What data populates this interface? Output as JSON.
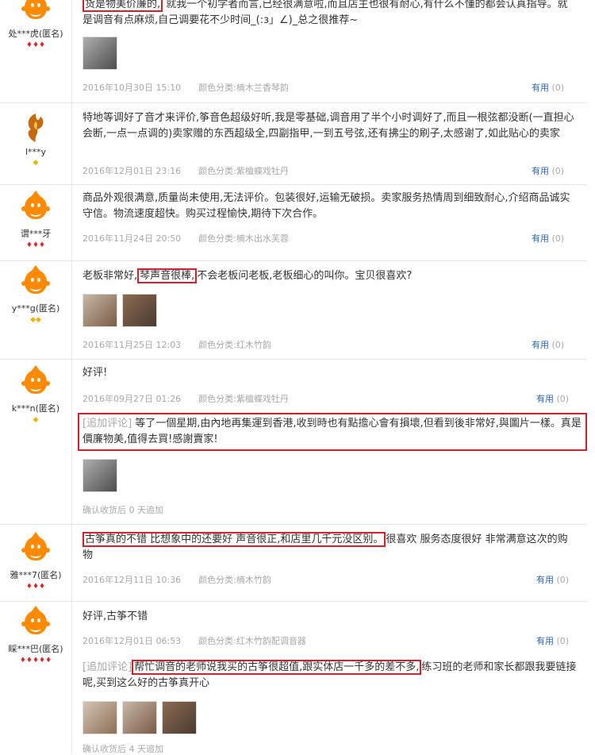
{
  "reviews": [
    {
      "user": "处***虎(匿名)",
      "ranks": "♦♦♦",
      "text_hl": "货是物美价廉的,",
      "text_rest": " 就我一个初学者而言,已经很满意啦,而且店主也很有耐心,有什么不懂的都会认真指导。就是调音有点麻烦,自己调要花不少时间_(:з」∠)_总之很推荐~",
      "date": "2016年10月30日 15:10",
      "color": "颜色分类:楠木兰香琴韵",
      "helpful": "有用",
      "count": "(0)"
    },
    {
      "user": "l***y",
      "ranks": "◆",
      "text": "特地等调好了音才来评价,筝音色超级好听,我是零基础,调音用了半个小时调好了,而且一根弦都没断(一直担心会断,一点一点调的)卖家赠的东西超级全,四副指甲,一到五号弦,还有拂尘的刷子,太感谢了,如此贴心的卖家",
      "date": "2016年12月01日 23:16",
      "color": "颜色分类:紫檀蝶戏牡丹",
      "helpful": "有用",
      "count": "(0)"
    },
    {
      "user": "谓***牙",
      "ranks": "♦♦♦",
      "text": "商品外观很满意,质量尚未使用,无法评价。包装很好,运输无破损。卖家服务热情周到细致耐心,介绍商品诚实守信。物流速度超快。购买过程愉快,期待下次合作。",
      "date": "2016年11月24日 20:50",
      "color": "颜色分类:楠木出水芙蓉",
      "helpful": "有用",
      "count": "(0)"
    },
    {
      "user": "y***g(匿名)",
      "ranks": "◆◆",
      "text_pre": "老板非常好,",
      "text_hl": "琴声音很棒,",
      "text_rest": "不会老板问老板,老板细心的叫你。宝贝很喜欢?",
      "date": "2016年11月25日 12:03",
      "color": "颜色分类:红木竹韵",
      "helpful": "有用",
      "count": "(0)"
    },
    {
      "user": "k***n(匿名)",
      "ranks": "◆",
      "text": "好评!",
      "date": "2016年09月27日 01:26",
      "color": "颜色分类:紫檀蝶戏牡丹",
      "helpful": "有用",
      "count": "(0)",
      "add_label": "[追加评论]",
      "add_text": "等了一個星期,由內地再集運到香港,收到時也有點擔心會有損壞,但看到後非常好,與圖片一樣。真是價廉物美,值得去買!感謝賣家!",
      "add_note": "确认收货后 0 天追加"
    },
    {
      "user": "雅***7(匿名)",
      "ranks": "♦♦♦",
      "text_hl": "古筝真的不错 比想象中的还要好 声音很正,和店里几千元没区别。",
      "text_rest": "很喜欢 服务态度很好 非常满意这次的购物",
      "date": "2016年12月11日 10:36",
      "color": "颜色分类:楠木竹韵",
      "helpful": "有用",
      "count": "(0)"
    },
    {
      "user": "睬***巴(匿名)",
      "ranks": "♦♦♦♦♦",
      "text": "好评,古筝不错",
      "date": "2016年12月01日 06:53",
      "color": "颜色分类:红木竹韵配调音器",
      "helpful": "有用",
      "count": "(0)",
      "add_label": "[追加评论]",
      "add_hl": "帮忙调音的老师说我买的古筝很超值,跟实体店一千多的差不多,",
      "add_rest": "练习班的老师和家长都跟我要链接呢,买到这么好的古筝真开心",
      "add_note": "确认收货后 4 天追加"
    }
  ]
}
